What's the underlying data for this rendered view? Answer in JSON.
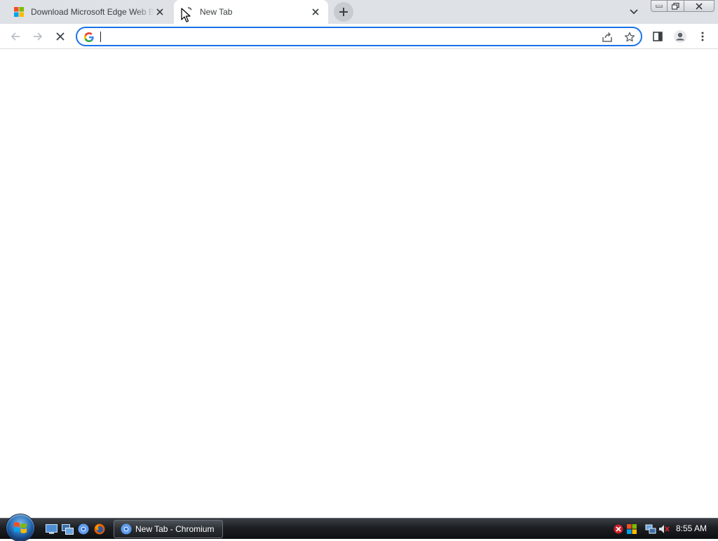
{
  "browser": {
    "tabs": [
      {
        "title": "Download Microsoft Edge Web Browser | Microsoft",
        "active": false,
        "favicon": "microsoft-logo-icon"
      },
      {
        "title": "New Tab",
        "active": true,
        "favicon": "loading-spinner-icon"
      }
    ],
    "omnibox": {
      "value": "",
      "placeholder": ""
    }
  },
  "taskbar": {
    "window_button_label": "New Tab - Chromium",
    "clock": "8:55 AM"
  },
  "colors": {
    "tabstrip_bg": "#dee1e6",
    "accent": "#1a73e8",
    "taskbar_bg": "#1c1f23"
  }
}
